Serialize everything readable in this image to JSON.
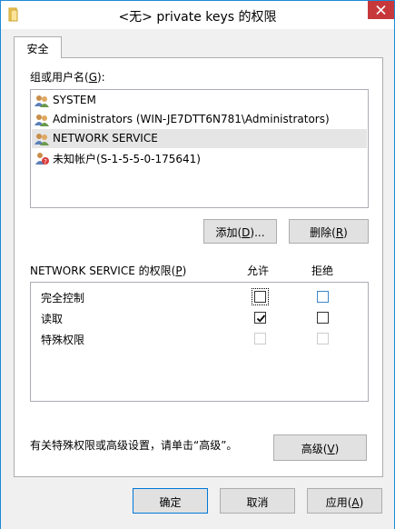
{
  "window": {
    "title": "<无> private keys 的权限",
    "close_icon": "close-icon"
  },
  "tabs": [
    {
      "label": "安全",
      "active": true
    }
  ],
  "users_section": {
    "label": "组或用户名(G):",
    "users": [
      {
        "name": "SYSTEM",
        "icon": "users-icon",
        "selected": false
      },
      {
        "name": "Administrators (WIN-JE7DTT6N781\\Administrators)",
        "icon": "users-icon",
        "selected": false
      },
      {
        "name": "NETWORK SERVICE",
        "icon": "users-icon",
        "selected": true
      },
      {
        "name": "未知帐户(S-1-5-5-0-175641)",
        "icon": "unknown-user-icon",
        "selected": false
      }
    ],
    "add_button": "添加(D)...",
    "remove_button": "删除(R)"
  },
  "permissions_section": {
    "label": "NETWORK SERVICE 的权限(P)",
    "allow_header": "允许",
    "deny_header": "拒绝",
    "rows": [
      {
        "name": "完全控制",
        "allow": false,
        "deny": false,
        "allow_focused": true,
        "enabled": true
      },
      {
        "name": "读取",
        "allow": true,
        "deny": false,
        "allow_focused": false,
        "enabled": true
      },
      {
        "name": "特殊权限",
        "allow": false,
        "deny": false,
        "allow_focused": false,
        "enabled": false
      }
    ]
  },
  "advanced": {
    "hint": "有关特殊权限或高级设置，请单击“高级”。",
    "button": "高级(V)"
  },
  "footer": {
    "ok": "确定",
    "cancel": "取消",
    "apply": "应用(A)"
  },
  "colors": {
    "accent": "#0078d7",
    "close": "#c7383b",
    "selection": "#e5e5e5"
  }
}
